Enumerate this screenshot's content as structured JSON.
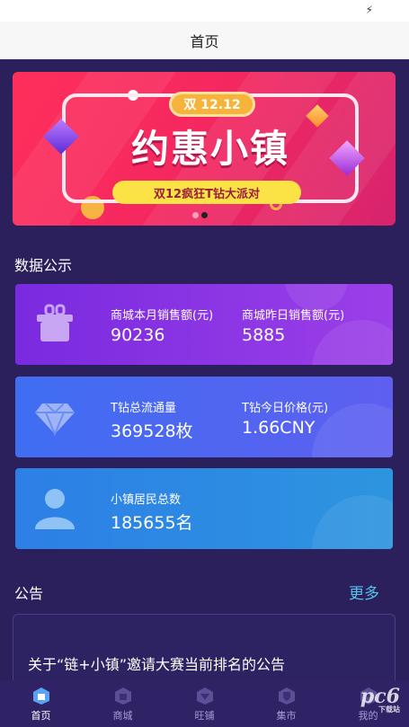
{
  "status_bar": {
    "icon": "bolt-icon"
  },
  "header": {
    "title": "首页"
  },
  "banner": {
    "date_badge": "双 12.12",
    "headline": "约惠小镇",
    "subline": "双12疯狂T钻大派对",
    "slide_count": 2,
    "active_slide": 2
  },
  "data_section": {
    "title": "数据公示"
  },
  "cards": [
    {
      "icon": "gift-box-icon",
      "stats": [
        {
          "label": "商城本月销售额(元)",
          "value": "90236"
        },
        {
          "label": "商城昨日销售额(元)",
          "value": "5885"
        }
      ]
    },
    {
      "icon": "diamond-icon",
      "stats": [
        {
          "label": "T钻总流通量",
          "value": "369528枚"
        },
        {
          "label": "T钻今日价格(元)",
          "value": "1.66CNY"
        }
      ]
    },
    {
      "icon": "person-icon",
      "stats": [
        {
          "label": "小镇居民总数",
          "value": "185655名"
        }
      ]
    }
  ],
  "notice": {
    "title": "公告",
    "more_label": "更多",
    "items": [
      {
        "text": "关于“链+小镇”邀请大赛当前排名的公告"
      }
    ]
  },
  "tabs": [
    {
      "label": "首页",
      "icon": "home-icon",
      "active": true
    },
    {
      "label": "商城",
      "icon": "shop-icon",
      "active": false
    },
    {
      "label": "旺铺",
      "icon": "store-icon",
      "active": false
    },
    {
      "label": "集市",
      "icon": "market-icon",
      "active": false
    },
    {
      "label": "我的",
      "icon": "profile-icon",
      "active": false
    }
  ],
  "watermark": {
    "text": "pc6",
    "sub": "下载站"
  },
  "colors": {
    "background": "#2b1f5c",
    "card1": "#8a2be2",
    "card2": "#4a6cf0",
    "card3": "#2d86e0",
    "more_link": "#55c3e8"
  }
}
